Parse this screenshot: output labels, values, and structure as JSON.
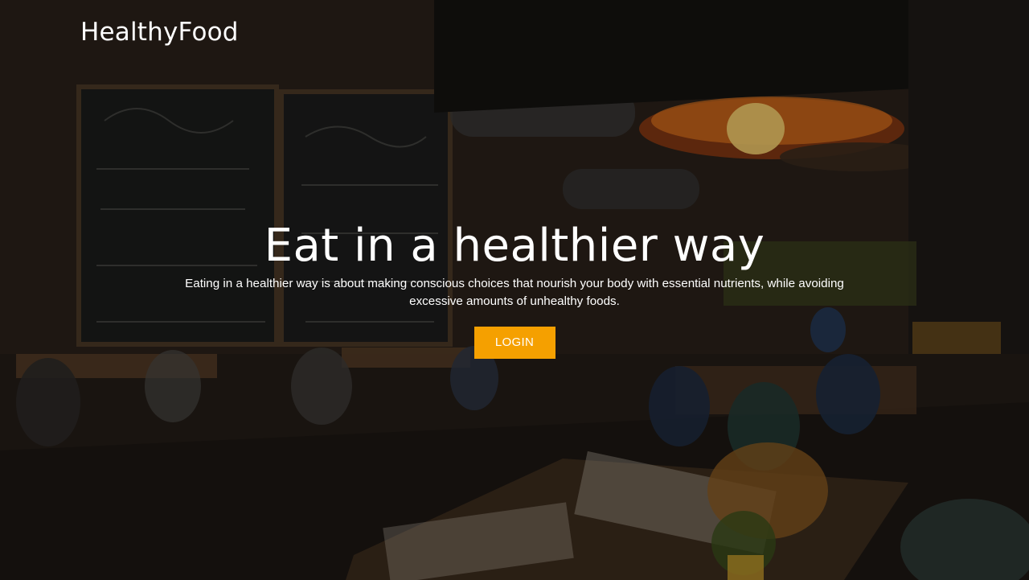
{
  "header": {
    "logo_text": "HealthyFood"
  },
  "hero": {
    "headline": "Eat in a healthier way",
    "subtext": "Eating in a healthier way is about making conscious choices that nourish your body with essential nutrients, while avoiding excessive amounts of unhealthy foods.",
    "login_label": "LOGIN",
    "background": "restaurant interior photo"
  },
  "colors": {
    "accent": "#f5a000",
    "text": "#ffffff"
  }
}
